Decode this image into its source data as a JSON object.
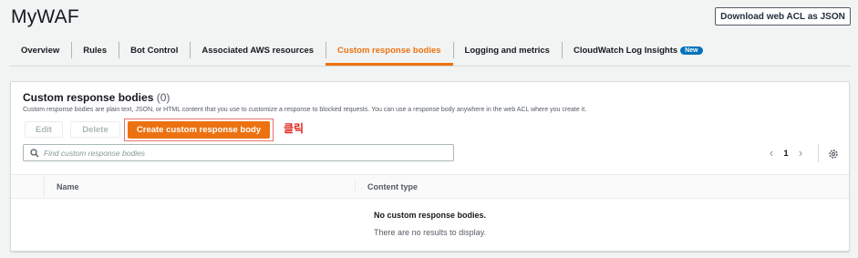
{
  "page": {
    "title": "MyWAF"
  },
  "header": {
    "download_label": "Download web ACL as JSON"
  },
  "tabs": [
    {
      "label": "Overview"
    },
    {
      "label": "Rules"
    },
    {
      "label": "Bot Control"
    },
    {
      "label": "Associated AWS resources"
    },
    {
      "label": "Custom response bodies",
      "active": true
    },
    {
      "label": "Logging and metrics"
    },
    {
      "label": "CloudWatch Log Insights",
      "badge": "New"
    }
  ],
  "panel": {
    "title": "Custom response bodies",
    "count": "(0)",
    "description": "Custom response bodies are plain text, JSON, or HTML content that you use to customize a response to blocked requests. You can use a response body anywhere in the web ACL where you create it.",
    "edit_label": "Edit",
    "delete_label": "Delete",
    "create_label": "Create custom response body",
    "annotation": "클릭",
    "search_placeholder": "Find custom response bodies",
    "page_number": "1",
    "columns": [
      "Name",
      "Content type"
    ],
    "empty_title": "No custom response bodies.",
    "empty_subtitle": "There are no results to display."
  },
  "colors": {
    "accent": "#ec7211",
    "annotation": "#e0241a",
    "badge": "#0073bb"
  }
}
